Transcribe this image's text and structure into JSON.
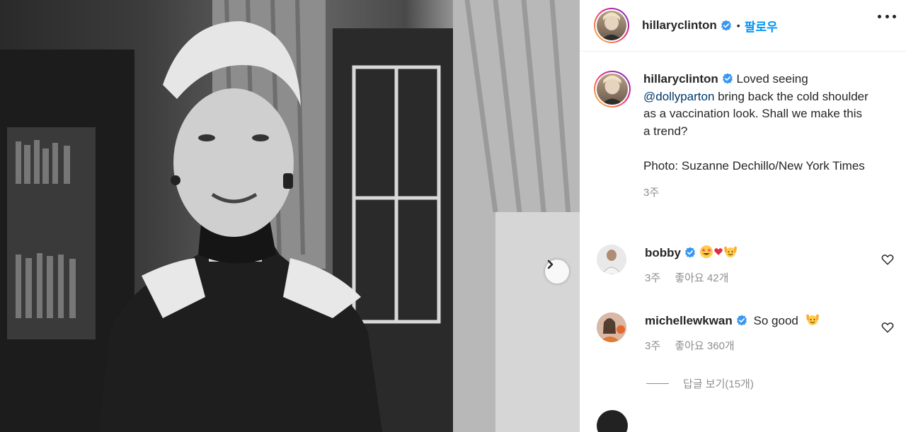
{
  "post": {
    "username": "hillaryclinton",
    "separator": "•",
    "follow_label": "팔로우",
    "more_icon": "more-options-icon",
    "next_icon": "chevron-right-icon"
  },
  "caption": {
    "username": "hillaryclinton",
    "line1": " Loved seeing ",
    "mention": "@dollyparton",
    "line2": " bring back the cold shoulder as a vaccination look. Shall we make this a trend?",
    "photo_credit": "Photo: Suzanne Dechillo/New York Times",
    "time": "3주"
  },
  "comments": [
    {
      "username": "bobby",
      "text": "",
      "emojis": [
        "grinning-star-face",
        "red-heart",
        "raising-hands"
      ],
      "time": "3주",
      "likes": "좋아요 42개"
    },
    {
      "username": "michellewkwan",
      "text": "So good",
      "emojis": [
        "raising-hands"
      ],
      "time": "3주",
      "likes": "좋아요 360개"
    }
  ],
  "replies": {
    "label": "답글 보기(15개)"
  },
  "colors": {
    "accent": "#0095f6",
    "verified": "#3897f0",
    "text": "#262626",
    "muted": "#8e8e8e"
  }
}
